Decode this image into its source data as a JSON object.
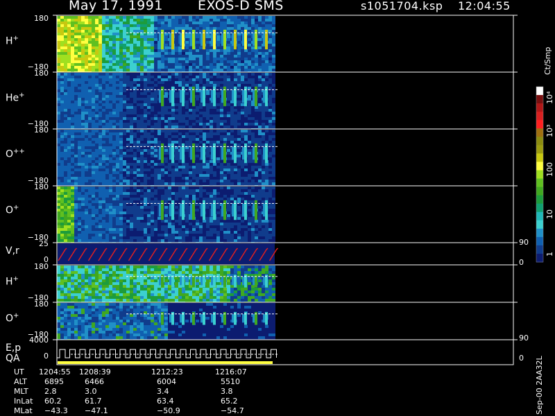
{
  "header": {
    "date": "May 17, 1991",
    "instrument": "EXOS-D SMS",
    "file": "s1051704.ksp",
    "time": "12:04:55"
  },
  "panels": [
    {
      "label": "H",
      "sup": "+",
      "ymax": "180",
      "ymin": "−180"
    },
    {
      "label": "He",
      "sup": "+",
      "ymax": "180",
      "ymin": "−180"
    },
    {
      "label": "O",
      "sup": "++",
      "ymax": "180",
      "ymin": "−180"
    },
    {
      "label": "O",
      "sup": "+",
      "ymax": "180",
      "ymin": "−180"
    },
    {
      "label": "V,r",
      "sup": "",
      "ymax": "25",
      "ymin": "0",
      "rmax": "90",
      "rmin": "0"
    },
    {
      "label": "H",
      "sup": "+",
      "ymax": "180",
      "ymin": "−180"
    },
    {
      "label": "O",
      "sup": "+",
      "ymax": "180",
      "ymin": "−180"
    },
    {
      "label": "E,p",
      "label2": "QA",
      "sup": "",
      "ymax": "4000",
      "ymin": "0",
      "rmax": "90",
      "rmin": "0"
    }
  ],
  "colorbar": {
    "unit": "Ct/Smp",
    "ticks": [
      "10⁴",
      "10³",
      "100",
      "10",
      "1"
    ],
    "colors": [
      "#ffffff",
      "#7a1010",
      "#b01818",
      "#d82020",
      "#ff2020",
      "#a07010",
      "#8c8c10",
      "#9c9c10",
      "#c8c810",
      "#ffff40",
      "#a0e020",
      "#60c020",
      "#40a820",
      "#1c9c3c",
      "#10a070",
      "#20b8b8",
      "#3cd0d0",
      "#2090c8",
      "#1060b0",
      "#103c8c",
      "#0c1c70"
    ],
    "min": 1,
    "max": 10000,
    "scale": "log"
  },
  "footer": {
    "rows": [
      {
        "label": "UT",
        "values": [
          "1204:55",
          "1208:39",
          "1212:23",
          "1216:07"
        ]
      },
      {
        "label": "ALT",
        "values": [
          "6895",
          "6466",
          "6004",
          "5510"
        ]
      },
      {
        "label": "MLT",
        "values": [
          "2.8",
          "3.0",
          "3.4",
          "3.8"
        ]
      },
      {
        "label": "InLat",
        "values": [
          "60.2",
          "61.7",
          "63.4",
          "65.2"
        ]
      },
      {
        "label": "MLat",
        "values": [
          "−43.3",
          "−47.1",
          "−50.9",
          "−54.7"
        ]
      }
    ],
    "stamp": "Sep-00 2AA32L"
  },
  "chart_data": {
    "type": "heatmap",
    "title": "May 17, 1991   EXOS-D SMS   s1051704.ksp  12:04:55",
    "x_axis_ticks": [
      "1204:55",
      "1208:39",
      "1212:23",
      "1216:07"
    ],
    "panels": [
      "H+",
      "He+",
      "O++",
      "O+",
      "V,r",
      "H+",
      "O+",
      "E,p QA"
    ],
    "y_range_pitch_deg": [
      -180,
      180
    ],
    "colorscale_ct_per_sample": [
      1,
      10000
    ],
    "data_extent": "data present from start to approx. 1218 UT; no data afterwards"
  }
}
